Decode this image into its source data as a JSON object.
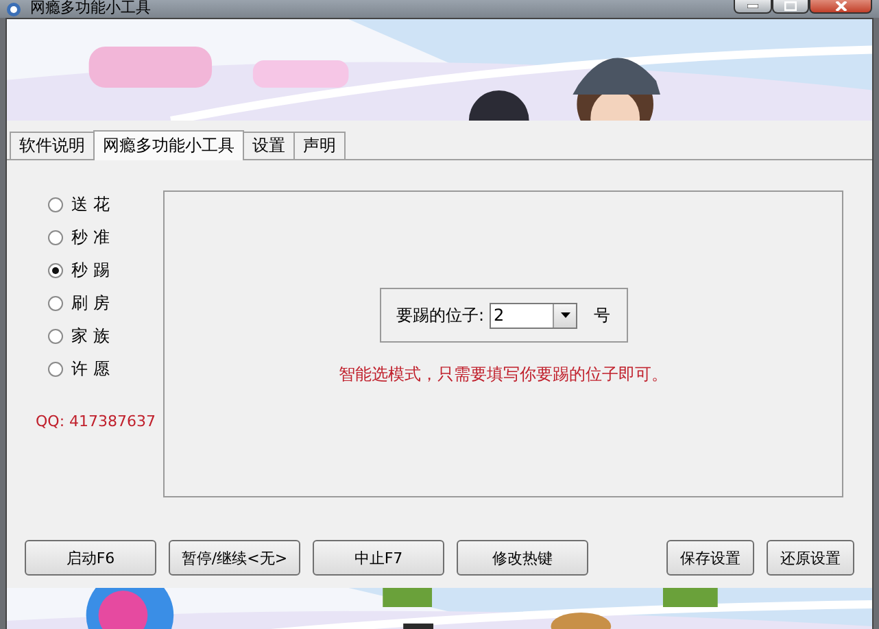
{
  "window": {
    "title": "网瘾多功能小工具"
  },
  "tabs": [
    {
      "label": "软件说明",
      "selected": false
    },
    {
      "label": "网瘾多功能小工具",
      "selected": true
    },
    {
      "label": "设置",
      "selected": false
    },
    {
      "label": "声明",
      "selected": false
    }
  ],
  "modes": [
    {
      "label": "送 花",
      "selected": false
    },
    {
      "label": "秒 准",
      "selected": false
    },
    {
      "label": "秒 踢",
      "selected": true
    },
    {
      "label": "刷 房",
      "selected": false
    },
    {
      "label": "家 族",
      "selected": false
    },
    {
      "label": "许 愿",
      "selected": false
    }
  ],
  "qq": "QQ: 417387637",
  "seat": {
    "label": "要踢的位子:",
    "value": "2",
    "unit": "号"
  },
  "hint": "智能选模式，只需要填写你要踢的位子即可。",
  "buttons": [
    "启动F6",
    "暂停/继续<无>",
    "中止F7",
    "修改热键"
  ],
  "settings_buttons": [
    "保存设置",
    "还原设置"
  ]
}
